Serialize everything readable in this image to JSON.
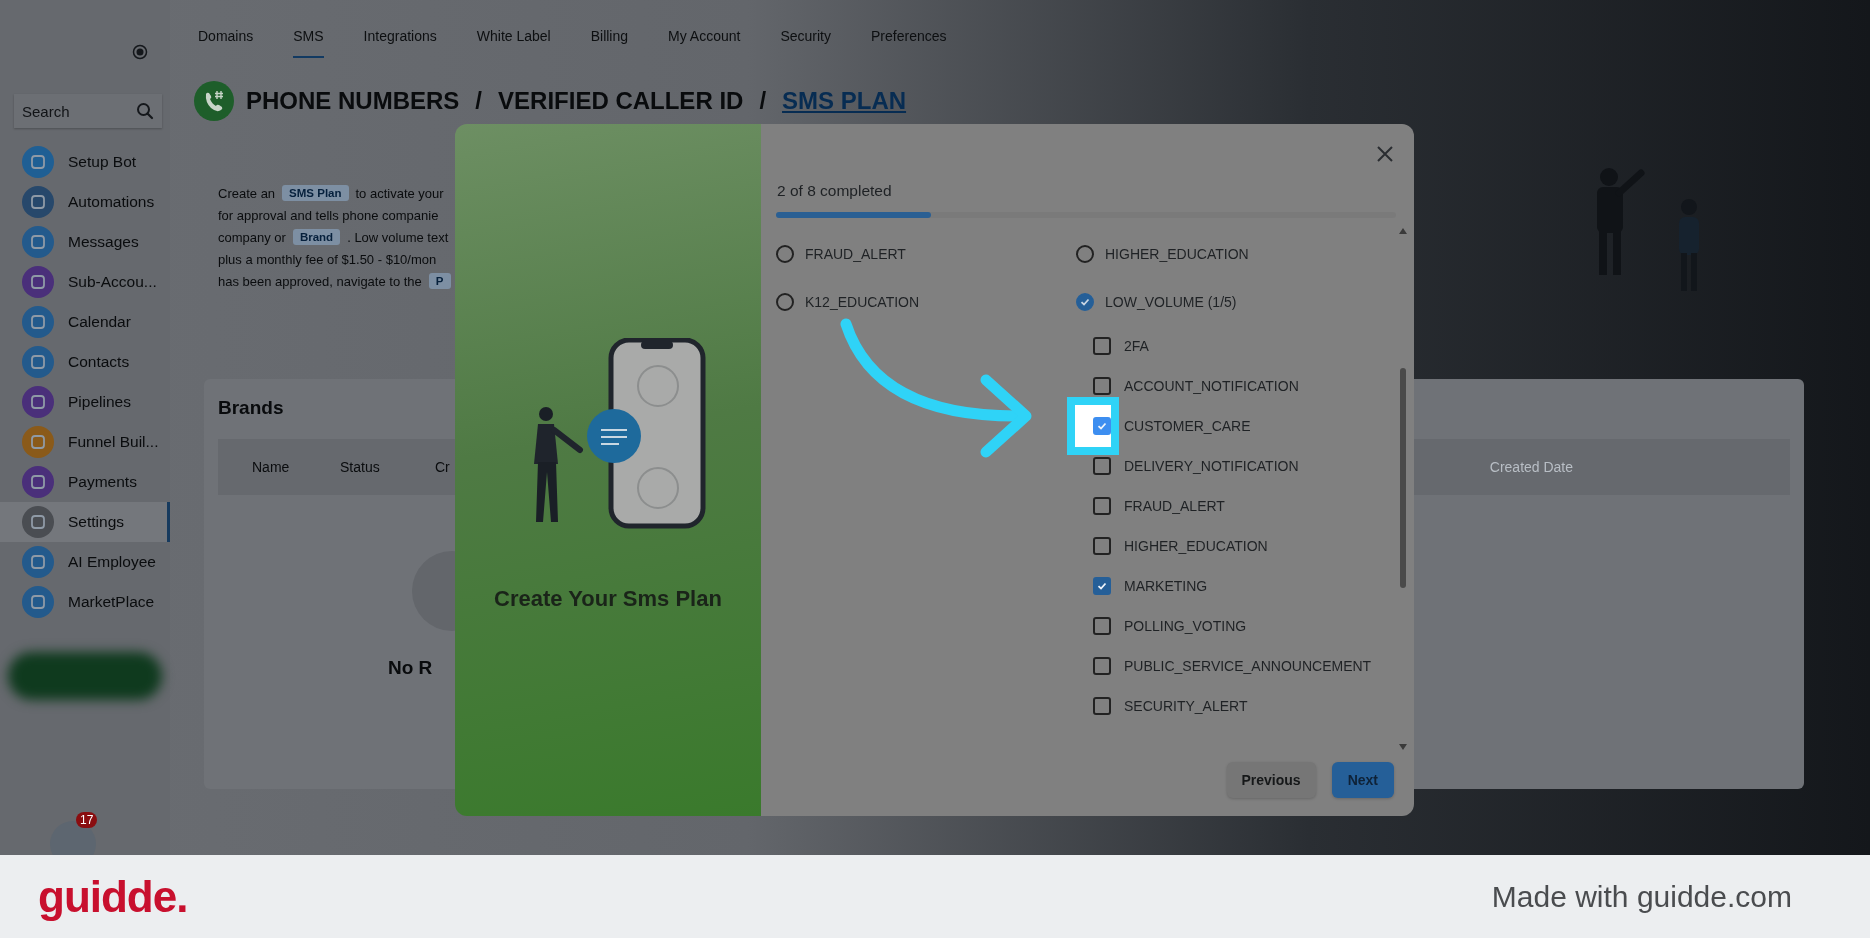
{
  "top_tabs": [
    {
      "label": "Domains",
      "selected": false
    },
    {
      "label": "SMS",
      "selected": true
    },
    {
      "label": "Integrations",
      "selected": false
    },
    {
      "label": "White Label",
      "selected": false
    },
    {
      "label": "Billing",
      "selected": false
    },
    {
      "label": "My Account",
      "selected": false
    },
    {
      "label": "Security",
      "selected": false
    },
    {
      "label": "Preferences",
      "selected": false
    }
  ],
  "sidebar": {
    "search": {
      "placeholder": "Search"
    },
    "items": [
      {
        "label": "Setup Bot",
        "selected": false,
        "color": "#1f5f94"
      },
      {
        "label": "Automations",
        "selected": false,
        "color": "#27486b"
      },
      {
        "label": "Messages",
        "selected": false,
        "color": "#235a8c"
      },
      {
        "label": "Sub-Accou...",
        "selected": false,
        "color": "#4a2f7a"
      },
      {
        "label": "Calendar",
        "selected": false,
        "color": "#235a8c"
      },
      {
        "label": "Contacts",
        "selected": false,
        "color": "#235a8c"
      },
      {
        "label": "Pipelines",
        "selected": false,
        "color": "#4a2f7a"
      },
      {
        "label": "Funnel Buil...",
        "selected": false,
        "color": "#8a5a1a"
      },
      {
        "label": "Payments",
        "selected": false,
        "color": "#4a2f7a"
      },
      {
        "label": "Settings",
        "selected": true,
        "color": "#4a4d52"
      },
      {
        "label": "AI Employee",
        "selected": false,
        "color": "#235a8c"
      },
      {
        "label": "MarketPlace",
        "selected": false,
        "color": "#235a8c"
      }
    ],
    "notification_count": "17"
  },
  "breadcrumb": [
    {
      "label": "PHONE NUMBERS",
      "selected": false
    },
    {
      "label": "VERIFIED CALLER ID",
      "selected": false
    },
    {
      "label": "SMS PLAN",
      "selected": true
    }
  ],
  "breadcrumb_separator": "/",
  "description": [
    [
      {
        "kind": "text",
        "text": "Create an"
      },
      {
        "kind": "chip",
        "text": "SMS Plan"
      },
      {
        "kind": "text",
        "text": "to activate your"
      }
    ],
    [
      {
        "kind": "text",
        "text": "for approval and tells phone companie"
      }
    ],
    [
      {
        "kind": "text",
        "text": "company or"
      },
      {
        "kind": "chip",
        "text": "Brand"
      },
      {
        "kind": "text",
        "text": ". Low volume text"
      }
    ],
    [
      {
        "kind": "text",
        "text": "plus a monthly fee of $1.50 - $10/mon"
      }
    ],
    [
      {
        "kind": "text",
        "text": "has been approved, navigate to the"
      },
      {
        "kind": "chip",
        "text": "P"
      }
    ]
  ],
  "brands": {
    "title": "Brands",
    "columns": [
      "Name",
      "Status",
      "Cr",
      "Created Date"
    ],
    "empty_text": "No R"
  },
  "modal": {
    "illustration_title": "Create Your Sms Plan",
    "progress": {
      "text": "2 of 8 completed",
      "level": 0.25
    },
    "columns": [
      {
        "options": [
          {
            "label": "FRAUD_ALERT",
            "selected": false
          },
          {
            "label": "K12_EDUCATION",
            "selected": false
          }
        ]
      },
      {
        "options": [
          {
            "label": "HIGHER_EDUCATION",
            "selected": false
          },
          {
            "label": "LOW_VOLUME (1/5)",
            "selected": true,
            "children": [
              {
                "label": "2FA",
                "checked": false,
                "highlighted": false
              },
              {
                "label": "ACCOUNT_NOTIFICATION",
                "checked": false,
                "highlighted": false
              },
              {
                "label": "CUSTOMER_CARE",
                "checked": true,
                "highlighted": true
              },
              {
                "label": "DELIVERY_NOTIFICATION",
                "checked": false,
                "highlighted": false
              },
              {
                "label": "FRAUD_ALERT",
                "checked": false,
                "highlighted": false
              },
              {
                "label": "HIGHER_EDUCATION",
                "checked": false,
                "highlighted": false
              },
              {
                "label": "MARKETING",
                "checked": true,
                "highlighted": false
              },
              {
                "label": "POLLING_VOTING",
                "checked": false,
                "highlighted": false
              },
              {
                "label": "PUBLIC_SERVICE_ANNOUNCEMENT",
                "checked": false,
                "highlighted": false
              },
              {
                "label": "SECURITY_ALERT",
                "checked": false,
                "highlighted": false
              }
            ]
          }
        ]
      }
    ],
    "buttons": [
      {
        "label": "Previous",
        "kind": "secondary"
      },
      {
        "label": "Next",
        "kind": "primary"
      }
    ]
  },
  "footer": {
    "logo": "guidde.",
    "tagline": "Made with guidde.com"
  }
}
